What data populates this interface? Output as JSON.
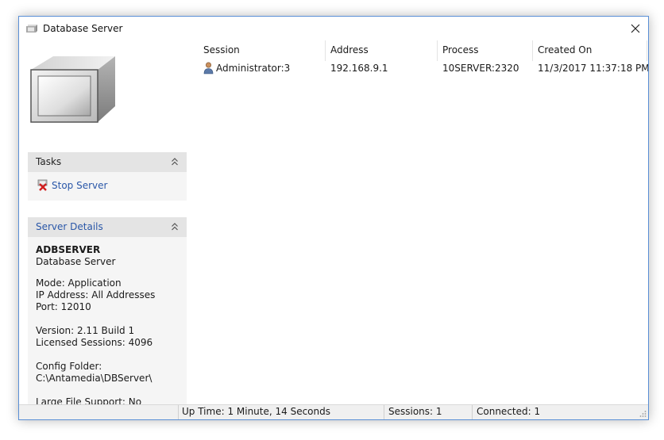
{
  "window": {
    "title": "Database Server"
  },
  "tasks": {
    "title": "Tasks",
    "stop_label": "Stop Server"
  },
  "details": {
    "title": "Server Details",
    "server_name": "ADBSERVER",
    "server_type": "Database Server",
    "mode": "Mode: Application",
    "ip": "IP Address: All Addresses",
    "port": "Port: 12010",
    "version": "Version: 2.11 Build 1",
    "licensed": "Licensed Sessions: 4096",
    "config_label": "Config Folder:",
    "config_path": "C:\\Antamedia\\DBServer\\",
    "large_file": "Large File Support: No"
  },
  "grid": {
    "columns": [
      "Session",
      "Address",
      "Process",
      "Created On"
    ],
    "rows": [
      {
        "session": "Administrator:3",
        "address": "192.168.9.1",
        "process": "10SERVER:2320",
        "created": "11/3/2017 11:37:18 PM"
      }
    ]
  },
  "status": {
    "uptime": "Up Time: 1 Minute, 14 Seconds",
    "sessions": "Sessions: 1",
    "connected": "Connected: 1"
  },
  "colors": {
    "accent": "#2a57a8",
    "border": "#5a8fd6",
    "stop": "#d11e1e"
  }
}
